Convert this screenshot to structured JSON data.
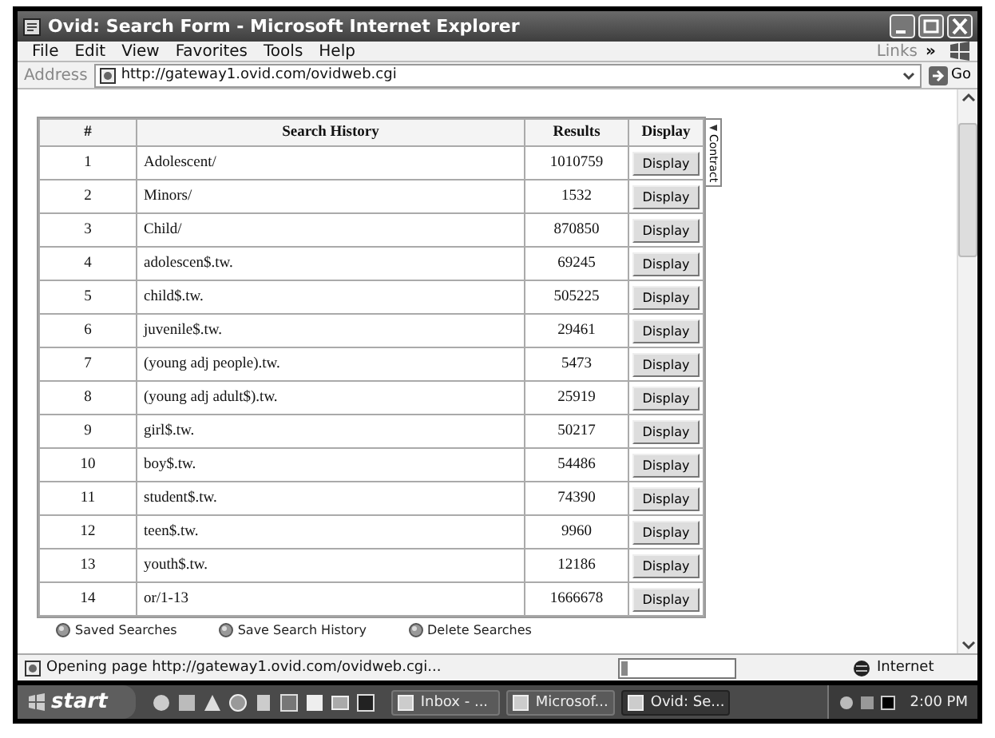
{
  "window": {
    "title": "Ovid: Search Form - Microsoft Internet Explorer"
  },
  "menu": [
    "File",
    "Edit",
    "View",
    "Favorites",
    "Tools",
    "Help"
  ],
  "links": {
    "label": "Links",
    "chevron": "»"
  },
  "address": {
    "label": "Address",
    "value": "http://gateway1.ovid.com/ovidweb.cgi",
    "go": "Go"
  },
  "history_table": {
    "columns": [
      "#",
      "Search History",
      "Results",
      "Display"
    ],
    "rows": [
      {
        "number": "1",
        "query": "Adolescent/",
        "results": "1010759",
        "action": "Display"
      },
      {
        "number": "2",
        "query": "Minors/",
        "results": "1532",
        "action": "Display"
      },
      {
        "number": "3",
        "query": "Child/",
        "results": "870850",
        "action": "Display"
      },
      {
        "number": "4",
        "query": "adolescen$.tw.",
        "results": "69245",
        "action": "Display"
      },
      {
        "number": "5",
        "query": "child$.tw.",
        "results": "505225",
        "action": "Display"
      },
      {
        "number": "6",
        "query": "juvenile$.tw.",
        "results": "29461",
        "action": "Display"
      },
      {
        "number": "7",
        "query": "(young adj people).tw.",
        "results": "5473",
        "action": "Display"
      },
      {
        "number": "8",
        "query": "(young adj adult$).tw.",
        "results": "25919",
        "action": "Display"
      },
      {
        "number": "9",
        "query": "girl$.tw.",
        "results": "50217",
        "action": "Display"
      },
      {
        "number": "10",
        "query": "boy$.tw.",
        "results": "54486",
        "action": "Display"
      },
      {
        "number": "11",
        "query": "student$.tw.",
        "results": "74390",
        "action": "Display"
      },
      {
        "number": "12",
        "query": "teen$.tw.",
        "results": "9960",
        "action": "Display"
      },
      {
        "number": "13",
        "query": "youth$.tw.",
        "results": "12186",
        "action": "Display"
      },
      {
        "number": "14",
        "query": "or/1-13",
        "results": "1666678",
        "action": "Display"
      }
    ]
  },
  "contract_tab": "Contract",
  "actions": [
    "Saved Searches",
    "Save Search History",
    "Delete Searches"
  ],
  "status_bar": {
    "text": "Opening page http://gateway1.ovid.com/ovidweb.cgi...",
    "progress": {
      "level": 0.05
    },
    "zone": "Internet"
  },
  "taskbar": {
    "start": "start",
    "tasks": [
      {
        "label": "Inbox - ...",
        "selected": false
      },
      {
        "label": "Microsof...",
        "selected": false
      },
      {
        "label": "Ovid: Se...",
        "selected": true
      }
    ],
    "clock": "2:00 PM"
  }
}
